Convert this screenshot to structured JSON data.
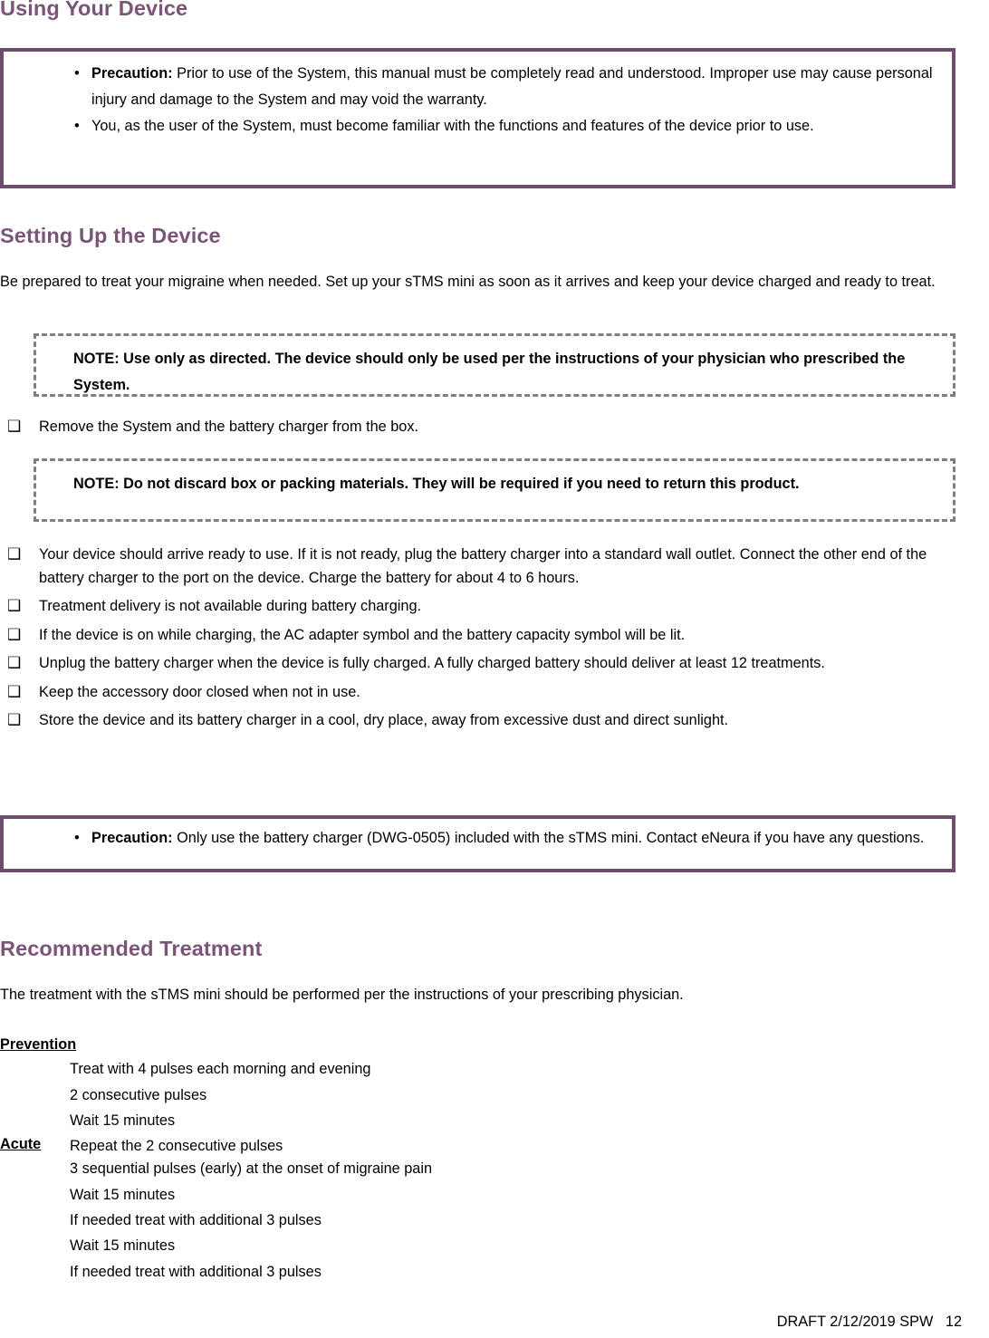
{
  "theme": {
    "heading_color": "#7A5577",
    "precaution_border_color": "#6E4D6C",
    "note_border_color": "#808080"
  },
  "sections": {
    "using_your_device": {
      "heading": "Using Your Device",
      "precaution": {
        "items": [
          {
            "bullet": "bullet-dot",
            "label": "Precaution:",
            "text": " Prior to use of the System, this manual must be completely read and understood. Improper use may cause personal injury and damage to the System and may void the warranty."
          },
          {
            "bullet": "bullet-dot",
            "label": "",
            "text": "You, as the user of the System, must become familiar with the functions and features of the device prior to use."
          }
        ]
      }
    },
    "setting_up_the_device": {
      "heading": "Setting Up the Device",
      "intro": "Be prepared to treat your migraine when needed.  Set up your sTMS mini as soon as it arrives and keep your device charged and ready to treat.",
      "note_1": "NOTE: Use only as directed.  The device should only be used per the instructions of your physician who prescribed the System.",
      "checklist_1": [
        "Remove the System and the battery charger from the box."
      ],
      "note_2": "NOTE: Do not discard box or packing materials.  They will be required if you need to return this product.",
      "checklist_2": [
        "Your device should arrive ready to use.  If it is not ready, plug the battery charger into a standard wall outlet.  Connect the other end of the battery charger to the port on the device.  Charge the battery for about 4 to 6 hours.",
        "Treatment delivery is not available during battery charging.",
        "If the device is on while charging, the AC adapter symbol and the battery capacity symbol will be lit.",
        "Unplug the battery charger when the device is fully charged.   A fully charged battery should deliver at least 12 treatments.",
        "Keep the accessory door closed when not in use.",
        "Store the device and its battery charger in a cool, dry place, away from excessive dust and direct sunlight."
      ],
      "precaution": {
        "items": [
          {
            "bullet": "bullet-dot",
            "label": "Precaution:",
            "text": " Only use the battery charger (DWG-0505) included with the sTMS mini.  Contact eNeura if you have any questions."
          }
        ]
      }
    },
    "recommended_treatment": {
      "heading": "Recommended Treatment",
      "intro": "The treatment with the sTMS mini should be performed per the instructions of your prescribing physician.",
      "regimens": [
        {
          "title": "Prevention",
          "steps": [
            "Treat with 4 pulses each morning and evening",
            "2 consecutive pulses",
            "Wait 15 minutes",
            "Repeat the 2 consecutive pulses"
          ]
        },
        {
          "title": "Acute",
          "steps": [
            "3 sequential pulses (early) at the onset of migraine pain",
            "Wait 15 minutes",
            "If needed treat with additional 3 pulses",
            "Wait 15 minutes",
            "If needed treat with additional 3 pulses"
          ]
        }
      ]
    }
  },
  "footer": {
    "text": "DRAFT 2/12/2019 SPW   12"
  },
  "glyphs": {
    "bullet_dot": "•",
    "checkbox": "❑"
  }
}
